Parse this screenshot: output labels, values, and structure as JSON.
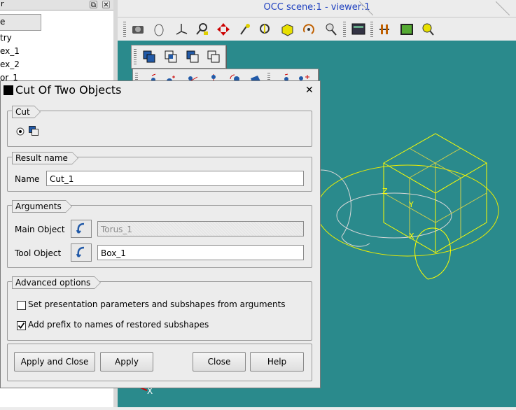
{
  "browser": {
    "title": "r",
    "header": "e",
    "items": [
      {
        "label": "try"
      },
      {
        "label": "ex_1"
      },
      {
        "label": "ex_2"
      },
      {
        "label": "or_1"
      }
    ]
  },
  "viewer": {
    "title": "OCC scene:1 - viewer:1"
  },
  "dialog": {
    "title": "Cut Of Two Objects",
    "cut_group": "Cut",
    "result_group": "Result name",
    "name_label": "Name",
    "name_value": "Cut_1",
    "arguments_group": "Arguments",
    "main_object_label": "Main Object",
    "main_object_value": "Torus_1",
    "tool_object_label": "Tool Object",
    "tool_object_value": "Box_1",
    "advanced_group": "Advanced options",
    "opt_presentation_label": "Set presentation parameters and subshapes from arguments",
    "opt_presentation_checked": false,
    "opt_prefix_label": "Add prefix to names of restored subshapes",
    "opt_prefix_checked": true,
    "btn_apply_close": "Apply and Close",
    "btn_apply": "Apply",
    "btn_close": "Close",
    "btn_help": "Help"
  },
  "scene": {
    "axis_x": "X",
    "axis_y": "Y",
    "axis_z": "Z",
    "triedron_x": "X"
  },
  "colors": {
    "scene_bg": "#2a8a8c",
    "selected_shape": "#ffff00",
    "wire": "#d8d8d8",
    "title_blue": "#1d3fbf"
  }
}
